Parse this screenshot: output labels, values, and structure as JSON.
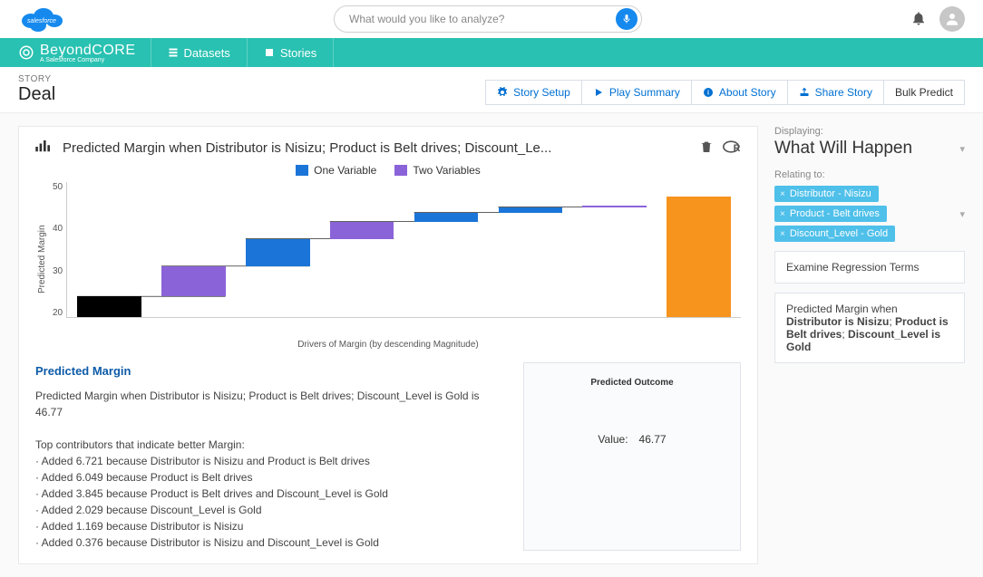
{
  "header": {
    "search_placeholder": "What would you like to analyze?"
  },
  "nav": {
    "brand": "BeyondCORE",
    "brand_sub": "A Salesforce Company",
    "items": [
      "Datasets",
      "Stories"
    ]
  },
  "sub": {
    "kicker": "STORY",
    "title": "Deal",
    "buttons": {
      "setup": "Story Setup",
      "play": "Play Summary",
      "about": "About Story",
      "share": "Share Story",
      "bulk": "Bulk Predict"
    }
  },
  "chart": {
    "title": "Predicted Margin when Distributor is Nisizu; Product is Belt drives; Discount_Le...",
    "legend": {
      "one": "One Variable",
      "two": "Two Variables"
    },
    "y_label": "Predicted Margin",
    "x_label": "Drivers of Margin (by descending Magnitude)",
    "y_ticks": [
      "50",
      "40",
      "30",
      "20"
    ]
  },
  "chart_data": {
    "type": "bar",
    "subtype": "waterfall",
    "ylabel": "Predicted Margin",
    "xlabel": "Drivers of Margin (by descending Magnitude)",
    "ylim": [
      20,
      50
    ],
    "legend": [
      "One Variable",
      "Two Variables"
    ],
    "bars": [
      {
        "name": "baseline",
        "start": 20,
        "end": 24.6,
        "color": "#000000",
        "series": "baseline"
      },
      {
        "name": "Distributor is Nisizu and Product is Belt drives",
        "start": 24.6,
        "end": 31.32,
        "delta": 6.721,
        "color": "#8b63d8",
        "series": "Two Variables"
      },
      {
        "name": "Product is Belt drives",
        "start": 31.32,
        "end": 37.37,
        "delta": 6.049,
        "color": "#1b75d8",
        "series": "One Variable"
      },
      {
        "name": "Product is Belt drives and Discount_Level is Gold",
        "start": 37.37,
        "end": 41.22,
        "delta": 3.845,
        "color": "#8b63d8",
        "series": "Two Variables"
      },
      {
        "name": "Discount_Level is Gold",
        "start": 41.22,
        "end": 43.25,
        "delta": 2.029,
        "color": "#1b75d8",
        "series": "One Variable"
      },
      {
        "name": "Distributor is Nisizu",
        "start": 43.25,
        "end": 44.42,
        "delta": 1.169,
        "color": "#1b75d8",
        "series": "One Variable"
      },
      {
        "name": "Distributor is Nisizu and Discount_Level is Gold",
        "start": 44.42,
        "end": 44.8,
        "delta": 0.376,
        "color": "#8b63d8",
        "series": "Two Variables"
      },
      {
        "name": "total",
        "start": 20,
        "end": 46.77,
        "color": "#f7941e",
        "series": "total"
      }
    ]
  },
  "text": {
    "heading": "Predicted Margin",
    "summary": "Predicted Margin when Distributor is Nisizu; Product is Belt drives; Discount_Level is Gold is 46.77",
    "contrib_heading": "Top contributors that indicate better Margin:",
    "contribs": [
      "· Added 6.721 because Distributor is Nisizu and Product is Belt drives",
      "· Added 6.049 because Product is Belt drives",
      "· Added 3.845 because Product is Belt drives and Discount_Level is Gold",
      "· Added 2.029 because Discount_Level is Gold",
      "· Added 1.169 because Distributor is Nisizu",
      "· Added 0.376 because Distributor is Nisizu and Discount_Level is Gold"
    ]
  },
  "outcome": {
    "heading": "Predicted Outcome",
    "label": "Value:",
    "value": "46.77"
  },
  "side": {
    "displaying_label": "Displaying:",
    "displaying_value": "What Will Happen",
    "relating_label": "Relating to:",
    "chips": [
      "Distributor - Nisizu",
      "Product - Belt drives",
      "Discount_Level - Gold"
    ],
    "box1": "Examine Regression Terms",
    "box2_pre": "Predicted Margin when ",
    "box2_b1": "Distributor is Nisizu",
    "box2_m1": "; ",
    "box2_b2": "Product is Belt drives",
    "box2_m2": "; ",
    "box2_b3": "Discount_Level is Gold"
  }
}
